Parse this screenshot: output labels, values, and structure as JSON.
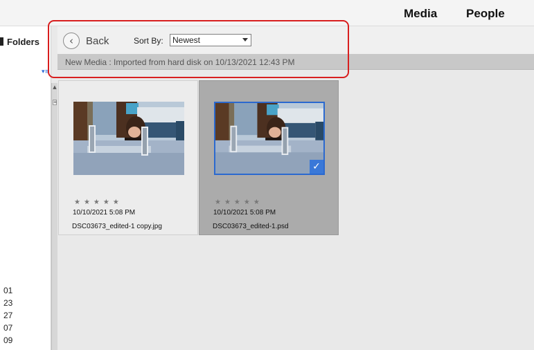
{
  "header": {
    "nav": [
      {
        "label": "Media"
      },
      {
        "label": "People"
      }
    ]
  },
  "left_panel": {
    "folders_label": "Folders",
    "year_items": [
      "01",
      "23",
      "27",
      "07",
      "09"
    ]
  },
  "toolbar": {
    "back_label": "Back",
    "sort_label": "Sort By:",
    "sort_value": "Newest"
  },
  "info_bar": {
    "text": "New Media : Imported from hard disk on 10/13/2021 12:43 PM"
  },
  "media": [
    {
      "date": "10/10/2021 5:08 PM",
      "filename": "DSC03673_edited-1 copy.jpg",
      "selected": false
    },
    {
      "date": "10/10/2021 5:08 PM",
      "filename": "DSC03673_edited-1.psd",
      "selected": true
    }
  ],
  "colors": {
    "highlight": "#d81e1e",
    "selection": "#2b69cf"
  }
}
